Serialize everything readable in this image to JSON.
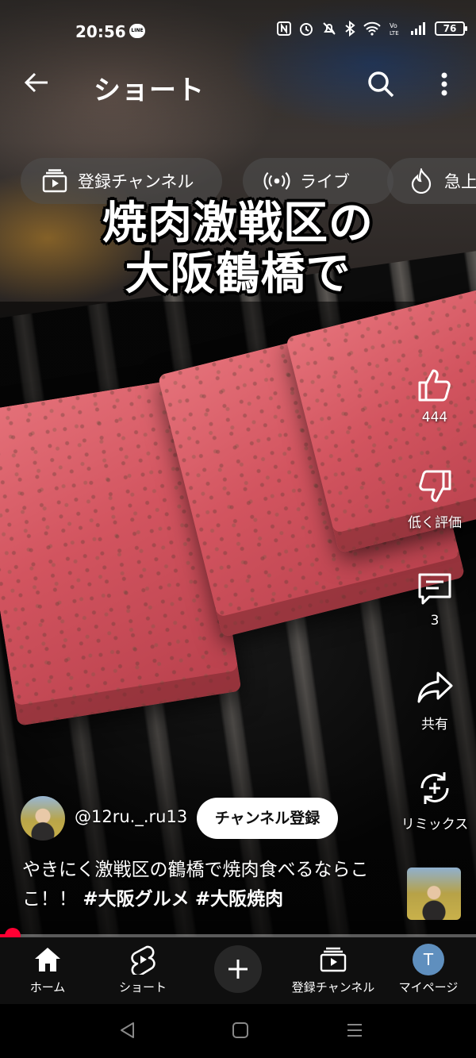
{
  "status_bar": {
    "time": "20:56",
    "line_badge": "LINE",
    "battery": "76",
    "icons": [
      "nfc-icon",
      "alarm-icon",
      "mute-icon",
      "bluetooth-icon",
      "wifi-icon",
      "volte-icon",
      "signal-icon",
      "battery-icon"
    ]
  },
  "header": {
    "title": "ショート",
    "icons": [
      "back-arrow-icon",
      "search-icon",
      "more-vert-icon"
    ]
  },
  "chips": [
    {
      "label": "登録チャンネル",
      "icon": "subscriptions-icon"
    },
    {
      "label": "ライブ",
      "icon": "live-icon"
    },
    {
      "label": "急上",
      "icon": "trending-icon"
    }
  ],
  "video": {
    "caption_line1": "焼肉激戦区の",
    "caption_line2": "大阪鶴橋で"
  },
  "actions": {
    "like_count": "444",
    "dislike_label": "低く評価",
    "comment_count": "3",
    "share_label": "共有",
    "remix_label": "リミックス"
  },
  "channel": {
    "name": "@12ru._.ru13",
    "subscribe_label": "チャンネル登録"
  },
  "description": {
    "text": "やきにく激戦区の鶴橋で焼肉食べるならここ！！",
    "tag1": "#大阪グルメ",
    "tag2": "#大阪焼肉"
  },
  "progress": {
    "fraction": 0.03,
    "color": "#ff0033"
  },
  "bottom_nav": {
    "home": "ホーム",
    "shorts": "ショート",
    "subscriptions": "登録チャンネル",
    "my_page": "マイページ",
    "avatar_letter": "T"
  },
  "colors": {
    "accent": "#ff0033",
    "nav_bg": "#0f0f0f",
    "avatar_bg": "#5f8fbe"
  }
}
